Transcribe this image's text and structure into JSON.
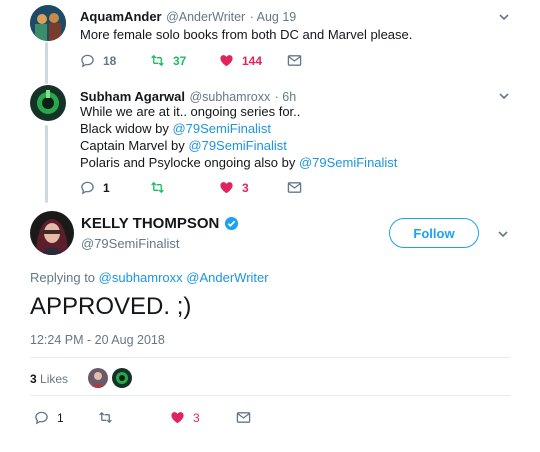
{
  "tweet1": {
    "name": "AquamAnder",
    "handle": "@AnderWriter",
    "time": "· Aug 19",
    "text": "More female solo books from both DC and Marvel please.",
    "replies": "18",
    "retweets": "37",
    "likes": "144"
  },
  "tweet2": {
    "name": "Subham Agarwal",
    "handle": "@subhamroxx",
    "time": "· 6h",
    "line1": "While we are at it.. ongoing series for..",
    "line2_prefix": "Black widow by ",
    "line3_prefix": "Captain Marvel by ",
    "line4_prefix": "Polaris and Psylocke ongoing also by ",
    "mention": "@79SemiFinalist",
    "replies": "1",
    "retweets": "",
    "likes": "3"
  },
  "main": {
    "name": "KELLY THOMPSON",
    "handle": "@79SemiFinalist",
    "follow_label": "Follow",
    "replying_prefix": "Replying to ",
    "replying_to_1": "@subhamroxx",
    "replying_to_2": "@AnderWriter",
    "text": "APPROVED. ;)",
    "timestamp": "12:24 PM - 20 Aug 2018",
    "likes_count": "3",
    "likes_label": "Likes",
    "replies": "1",
    "retweets": "",
    "likes": "3"
  },
  "colors": {
    "link": "#1b95e0",
    "retweet": "#17bf63",
    "like": "#e0245e",
    "verified": "#1da1f2"
  }
}
